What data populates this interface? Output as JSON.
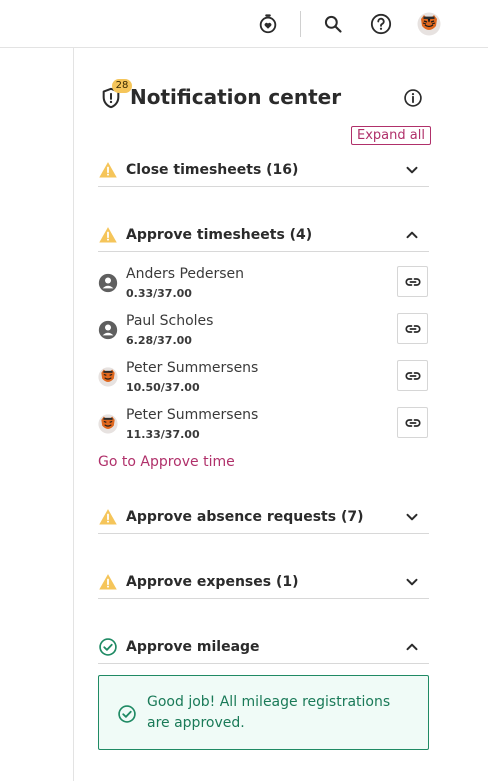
{
  "topbar": {
    "icons": [
      "stopwatch-icon",
      "search-icon",
      "help-icon",
      "tiger-avatar"
    ]
  },
  "panel": {
    "title": "Notification center",
    "badge_count": "28",
    "expand_all": "Expand all",
    "sections": {
      "close_timesheets": {
        "label": "Close timesheets (16)",
        "status": "warning",
        "expanded": false
      },
      "approve_timesheets": {
        "label": "Approve timesheets (4)",
        "status": "warning",
        "expanded": true
      },
      "approve_absence": {
        "label": "Approve absence requests (7)",
        "status": "warning",
        "expanded": false
      },
      "approve_expenses": {
        "label": "Approve expenses (1)",
        "status": "warning",
        "expanded": false
      },
      "approve_mileage": {
        "label": "Approve mileage",
        "status": "success",
        "expanded": true
      }
    },
    "timesheet_people": [
      {
        "name": "Anders Pedersen",
        "hours": "0.33/37.00",
        "avatar": "person-icon"
      },
      {
        "name": "Paul Scholes",
        "hours": "6.28/37.00",
        "avatar": "person-icon"
      },
      {
        "name": "Peter Summersens",
        "hours": "10.50/37.00",
        "avatar": "tiger-avatar"
      },
      {
        "name": "Peter Summersens",
        "hours": "11.33/37.00",
        "avatar": "tiger-avatar"
      }
    ],
    "goto_approve_time": "Go to Approve time",
    "mileage_message": "Good job! All mileage registrations are approved."
  },
  "colors": {
    "accent": "#b0306a",
    "warning": "#f5c55a",
    "success": "#1f8a64",
    "success_bg": "#f0fbf7"
  }
}
